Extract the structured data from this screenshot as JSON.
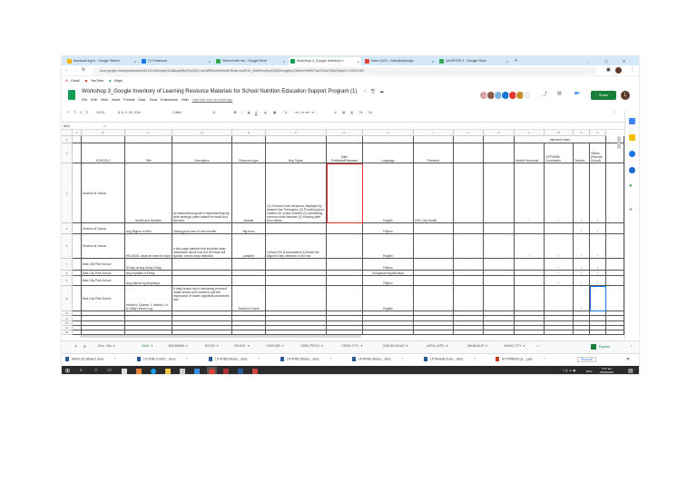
{
  "browser": {
    "tabs": [
      {
        "label": "facebook log in - Google Search",
        "color": "#f4b400"
      },
      {
        "label": "(7) Facebook",
        "color": "#1877f2"
      },
      {
        "label": "Shared with me - Google Drive",
        "color": "#34a853"
      },
      {
        "label": "Workshop 3_Google Inventory o",
        "color": "#0f9d58",
        "active": true
      },
      {
        "label": "Inbox (107) - lvtan@depedgo",
        "color": "#ea4335"
      },
      {
        "label": "QUARTER 1 - Google Drive",
        "color": "#34a853"
      }
    ],
    "new_tab": "+",
    "url": "docs.google.com/spreadsheets/d/1VGYtoi1cpbxp3Ga8sugkRtyOHuQ9hCnsOdfRSkmHAU/edit?fbclid=IwAR1U_eliaKtVmjHq4Q0000nekge6y1Q8umbOtef9S7azXGbsf27fdpH0#gid=1716301280",
    "bookmarks": [
      "Gmail",
      "YouTube",
      "Maps"
    ]
  },
  "doc": {
    "title": "Workshop 3_Google Inventory of Learning Resource Materials for School Nutrition Education Support  Program (1)",
    "menu": [
      "File",
      "Edit",
      "View",
      "Insert",
      "Format",
      "Data",
      "Tools",
      "Extensions",
      "Help"
    ],
    "last_edit": "Last edit was seconds ago",
    "share_label": "Share",
    "avatar_letter": "L",
    "zoom": "100%",
    "font": "Calibri",
    "font_size": "11",
    "cell_ref": "M10",
    "fx": "fx"
  },
  "columns": [
    "A",
    "B",
    "C",
    "D",
    "E",
    "F",
    "G",
    "H",
    "I",
    "J",
    "K",
    "L",
    "M",
    "N",
    "O"
  ],
  "header": {
    "intended_users": "Intended Users",
    "schools": "SCHOOLS",
    "title": "Title",
    "description": "Description",
    "resource_type": "Resource type",
    "key_topics": "Key Topics",
    "date": "Date Published/Released",
    "language": "Language",
    "partners": "Partner/s",
    "health": "Health Personnel",
    "gpp": "GPP/SMM Coordinator",
    "teacher": "Teacher",
    "others": "Others (Parents, School)"
  },
  "rows": [
    {
      "num": "4",
      "school": "Division of Carcar",
      "title": "Health and Nutrition",
      "desc": "An instructional guide in implementing city wide strategic plans related to health and Nutrition",
      "type": "Module",
      "topics": "(1) Common risks behaviors displayed by present Day Teenagers; (2) Providing good nutrition for school children (3) addressing common child illnesses (4) Keeping safe from rabies",
      "lang": "English",
      "partner": "USLI City Health",
      "h": "/",
      "g": "/",
      "t": "/",
      "o": "/"
    },
    {
      "num": "5",
      "school": "Division of Carcar",
      "title": "Ang Bigkon ni Wiio",
      "desc": "Taking good care of one's health",
      "type": "Big book",
      "topics": "",
      "lang": "Filipino",
      "partner": "",
      "h": "",
      "g": "",
      "t": "/",
      "o": "/"
    },
    {
      "num": "6",
      "school": "Division of Carcar",
      "title": "HIV/AIDS -what we need to know",
      "desc": "a four-page pamplet that provides basic  information about how the HIV/Aids will spread, and its early detection",
      "type": "pamplet",
      "topics": "(1)How HIV is transmitted (2) Break the stigma! Early detection is the key",
      "lang": "English",
      "partner": "",
      "h": "/",
      "g": "/",
      "t": "/",
      "o": "/"
    },
    {
      "num": "7",
      "school": "Bais City Pilot School",
      "title": "Si Aisy at ang Gulay Gang",
      "desc": "",
      "type": "",
      "topics": "",
      "lang": "Filipino",
      "partner": "",
      "h": "",
      "g": "/",
      "t": "/",
      "o": "/"
    },
    {
      "num": "8",
      "school": "Bais City Pilot School",
      "title": "Ang Kamatis ni Pelay",
      "desc": "",
      "type": "",
      "topics": "",
      "lang": "Sinugbuanong Binisaya",
      "partner": "",
      "h": "",
      "g": "/",
      "t": "/",
      "o": "/"
    },
    {
      "num": "9",
      "school": "Bais City Pilot School",
      "title": "Ang Alamat ng Ampalaya",
      "desc": "",
      "type": "",
      "topics": "",
      "lang": "Filipino",
      "partner": "",
      "h": "",
      "g": "/",
      "t": "/",
      "o": "/"
    },
    {
      "num": "10",
      "school": "Bais City Pilot School",
      "title": "Health 6, Quarter 1, Weeks 1 to 8: Daily Lesson Log",
      "desc": "A daily lesson log in discussing personal health issues and concerns and the importance of health appraisal procedures and",
      "type": "Teacher's Guide",
      "topics": "",
      "lang": "English",
      "partner": "",
      "h": "",
      "g": "",
      "t": "/",
      "o": ""
    }
  ],
  "row_numbers_top": [
    "2",
    "3"
  ],
  "row_numbers_bottom": [
    "11",
    "12",
    "13",
    "14",
    "15"
  ],
  "sheets": [
    "Gen. Info",
    "BAIS",
    "BAYAWAN",
    "BOGO",
    "BOHOL",
    "CARCAR",
    "CEBU PROV",
    "CEBU CITY",
    "GUIHULNGAN",
    "LAPU LAPU",
    "MANDAUE",
    "NAGA CITY"
  ],
  "active_sheet": "BAIS",
  "explore": "Explore",
  "downloads": [
    "AFBS-Q1-Week-2.docx",
    "LP-MTB-2-mOD....docx",
    "LP-MTB2-Modul....docx",
    "LP-MTB2-Modul....docx",
    "LP-MTB2-Modul....docx",
    "LP-Module-5-Qu....docx",
    "M-TORRES-Q1....pptx"
  ],
  "show_all": "Show all",
  "taskbar": {
    "lang": "ENG",
    "time": "9:17 am",
    "date": "02/08/2022"
  },
  "colors": {
    "accent": "#188038",
    "tabbar": "#d3e9f7",
    "taskbar": "#2b2b2b",
    "selection": "#1a73e8"
  }
}
